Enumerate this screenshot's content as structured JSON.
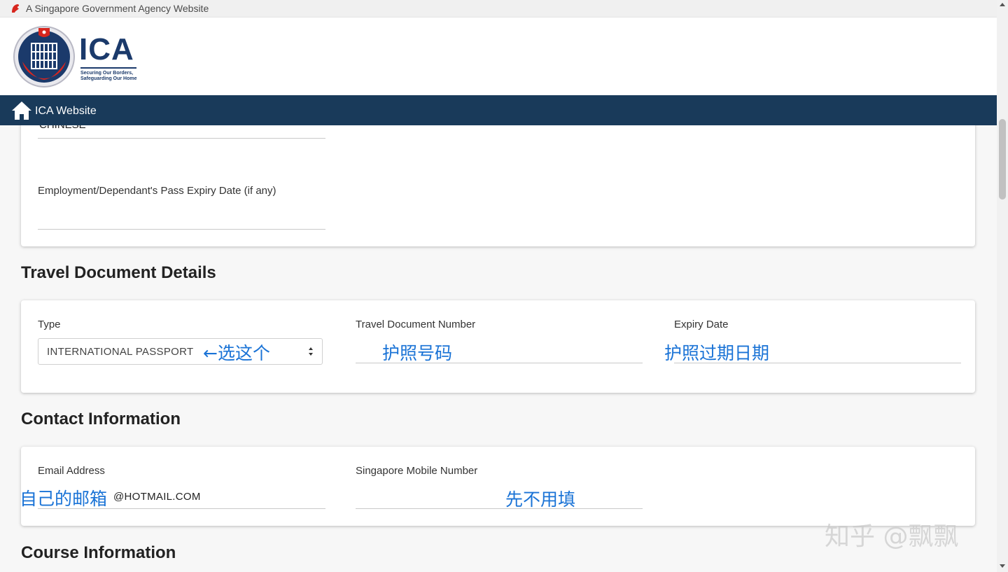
{
  "gov_bar": {
    "text": "A Singapore Government Agency Website"
  },
  "logo": {
    "name": "ICA",
    "tagline": "Securing Our Borders, Safeguarding Our Home"
  },
  "nav": {
    "home_label": "ICA Website"
  },
  "personal": {
    "nationality_value": "CHINESE",
    "pass_expiry_label": "Employment/Dependant's Pass Expiry Date (if any)",
    "pass_expiry_value": ""
  },
  "travel": {
    "title": "Travel Document Details",
    "type_label": "Type",
    "type_value": "INTERNATIONAL PASSPORT",
    "doc_number_label": "Travel Document Number",
    "doc_number_value": "",
    "expiry_label": "Expiry Date",
    "expiry_value": ""
  },
  "contact": {
    "title": "Contact Information",
    "email_label": "Email Address",
    "email_value": "@HOTMAIL.COM",
    "mobile_label": "Singapore Mobile Number",
    "mobile_value": ""
  },
  "course": {
    "title": "Course Information"
  },
  "annotations": {
    "select_this": "←选这个",
    "passport_number": "护照号码",
    "passport_expiry": "护照过期日期",
    "own_email": "自己的邮箱",
    "leave_blank": "先不用填"
  },
  "watermark": "知乎 @飘飘",
  "colors": {
    "navbar": "#193a5a",
    "annotation": "#1a73d6",
    "brand": "#1b3a6b"
  }
}
